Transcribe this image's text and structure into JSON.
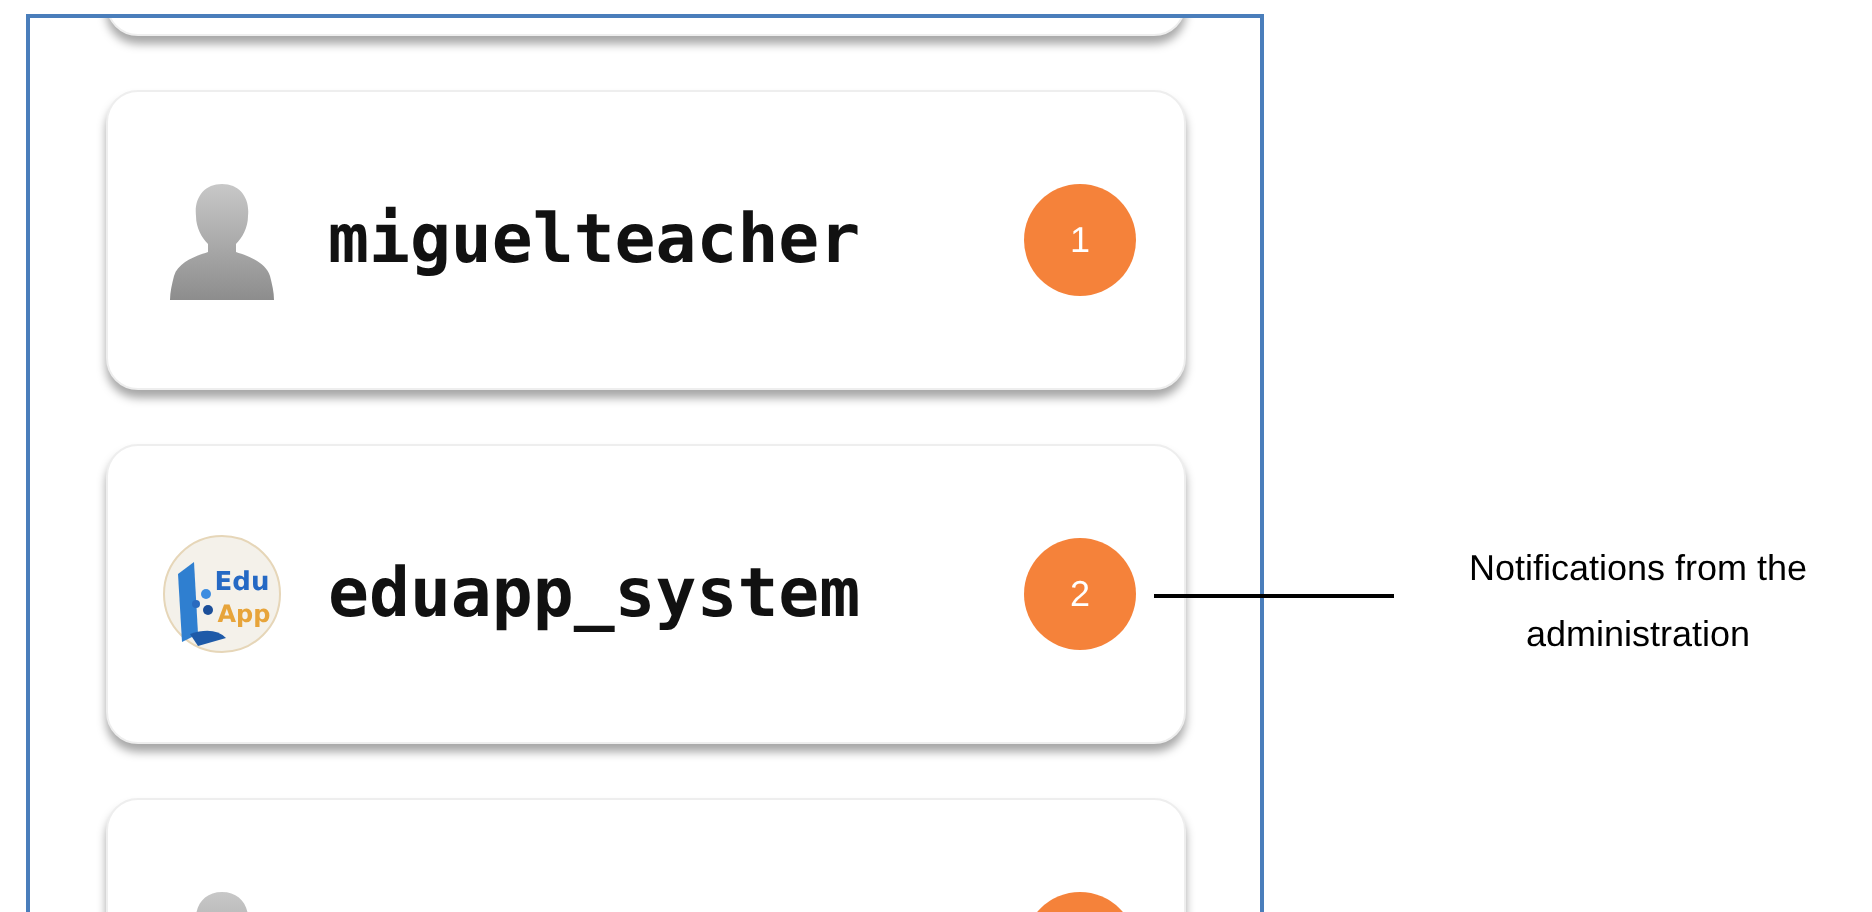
{
  "contacts": [
    {
      "kind": "blank"
    },
    {
      "kind": "silhouette",
      "name": "miguelteacher",
      "badge": "1"
    },
    {
      "kind": "logo",
      "logo_text": [
        "Edu",
        "App"
      ],
      "name": "eduapp_system",
      "badge": "2"
    },
    {
      "kind": "silhouette",
      "badge_shown": true
    }
  ],
  "annotation": {
    "text": "Notifications from the administration"
  }
}
